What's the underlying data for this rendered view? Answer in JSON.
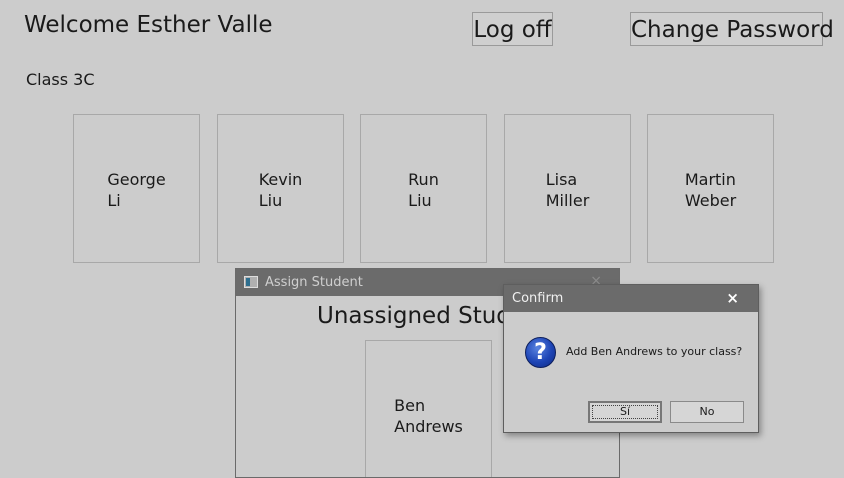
{
  "header": {
    "welcome": "Welcome Esther Valle",
    "log_off_label": "Log off",
    "change_password_label": "Change Password"
  },
  "class_label": "Class 3C",
  "students": [
    {
      "first": "George",
      "last": "Li"
    },
    {
      "first": "Kevin",
      "last": "Liu"
    },
    {
      "first": "Run",
      "last": "Liu"
    },
    {
      "first": "Lisa",
      "last": "Miller"
    },
    {
      "first": "Martin",
      "last": "Weber"
    }
  ],
  "assign_window": {
    "title": "Assign Student",
    "close_glyph": "×",
    "heading": "Unassigned Students",
    "students": [
      {
        "first": "Ben",
        "last": "Andrews"
      }
    ]
  },
  "confirm_dialog": {
    "title": "Confirm",
    "close_glyph": "×",
    "icon": "question-icon",
    "icon_glyph": "?",
    "message": "Add Ben Andrews to your class?",
    "yes_label": "Sí",
    "no_label": "No"
  },
  "colors": {
    "background": "#cccccc",
    "titlebar": "#6b6b6b",
    "question_icon": "#1d44b5"
  }
}
